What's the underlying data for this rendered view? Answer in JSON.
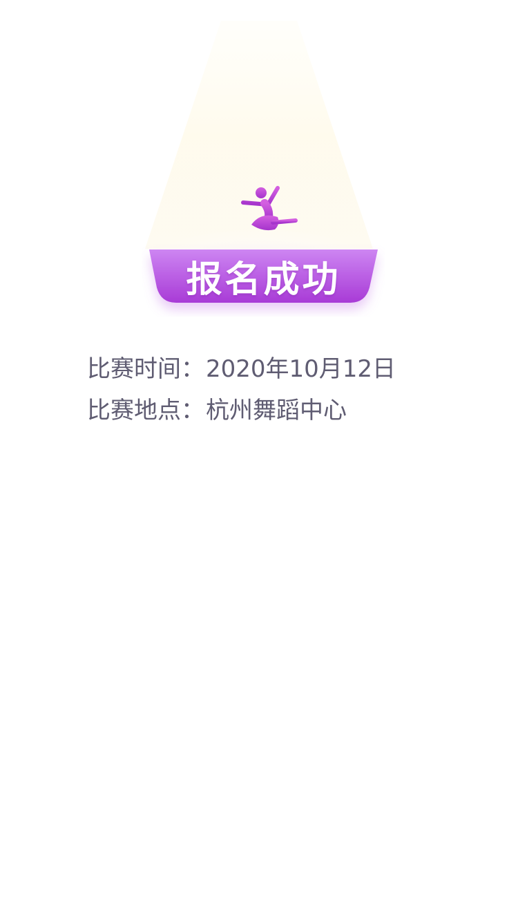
{
  "status": {
    "title": "报名成功"
  },
  "details": [
    {
      "label": "比赛时间：",
      "value": "2020年10月12日"
    },
    {
      "label": "比赛地点：",
      "value": "杭州舞蹈中心"
    }
  ],
  "colors": {
    "banner_top": "#ca7ef0",
    "banner_bottom": "#a93ad6",
    "dancer": "#c84fd8",
    "text": "#5f5c72",
    "spotlight": "#fffbe8"
  },
  "icons": {
    "dancer": "ballet-dancer-icon"
  }
}
